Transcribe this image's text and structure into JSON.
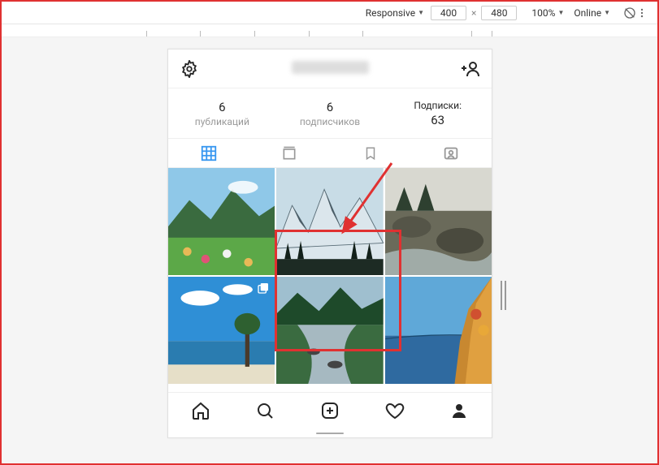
{
  "devtools": {
    "responsive_label": "Responsive",
    "width": "400",
    "height": "480",
    "zoom": "100%",
    "network": "Online"
  },
  "profile": {
    "username_hidden": true,
    "stats": {
      "posts": {
        "value": "6",
        "label": "публикаций"
      },
      "followers": {
        "value": "6",
        "label": "подписчиков"
      },
      "following": {
        "label": "Подписки:",
        "value": "63"
      }
    }
  },
  "tabs": [
    "grid",
    "feed",
    "saved",
    "tagged"
  ],
  "grid_items": [
    {
      "kind": "meadow",
      "multi": false
    },
    {
      "kind": "snow-peaks",
      "multi": false
    },
    {
      "kind": "rocky-stream",
      "multi": false
    },
    {
      "kind": "beach",
      "multi": true
    },
    {
      "kind": "forest-river",
      "multi": false
    },
    {
      "kind": "sea-autumn",
      "multi": false
    }
  ],
  "annotation": {
    "highlight_index": 1
  }
}
